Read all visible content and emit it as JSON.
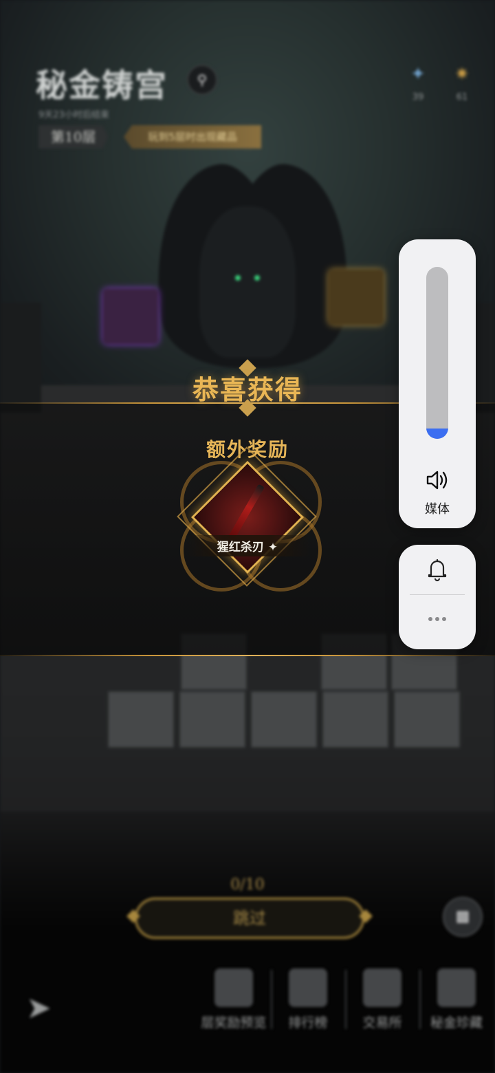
{
  "game": {
    "title": "秘金铸宫",
    "subtitle": "9天23小时后结束",
    "floor_label": "第10层",
    "floor_tip": "玩到5层时出现藏品",
    "resources": [
      {
        "icon": "crystal-icon",
        "value": "39"
      },
      {
        "icon": "star-coin-icon",
        "value": "61"
      }
    ]
  },
  "reward": {
    "title": "恭喜获得",
    "bonus_label": "额外奖励",
    "item_name": "猩红杀刃",
    "item_icon": "crimson-blade-icon"
  },
  "progress": {
    "text": "0/10",
    "skip_label": "跳过"
  },
  "bottom_nav": [
    {
      "label": "层奖励预览",
      "icon": "reward-preview-icon"
    },
    {
      "label": "排行榜",
      "icon": "trophy-icon"
    },
    {
      "label": "交易所",
      "icon": "exchange-icon"
    },
    {
      "label": "秘金珍藏",
      "icon": "treasure-icon"
    }
  ],
  "volume_panel": {
    "level_percent": 6,
    "label": "媒体",
    "accent": "#3b6ef1"
  }
}
